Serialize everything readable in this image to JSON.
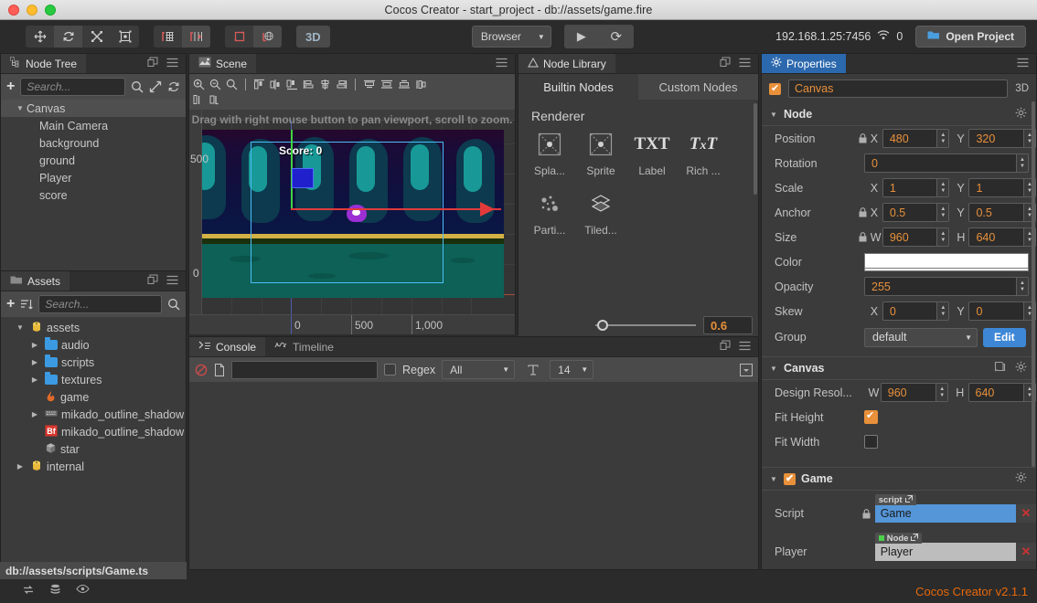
{
  "window": {
    "title": "Cocos Creator - start_project - db://assets/game.fire"
  },
  "toolbar": {
    "transform_tools": [
      {
        "name": "move-tool",
        "icon": "move-icon",
        "active": false
      },
      {
        "name": "rotate-tool",
        "icon": "rotate-icon",
        "active": true
      },
      {
        "name": "scale-tool",
        "icon": "scale-icon",
        "active": false
      },
      {
        "name": "rect-tool",
        "icon": "rect-transform-icon",
        "active": false
      }
    ],
    "snap_tools": [
      {
        "name": "snap-grid-tool",
        "icon": "snap-grid-icon"
      },
      {
        "name": "snap-point-tool",
        "icon": "snap-point-icon"
      }
    ],
    "pivot_tools": [
      {
        "name": "pivot-tool",
        "icon": "pivot-icon"
      },
      {
        "name": "global-coord-tool",
        "icon": "globe-icon"
      }
    ],
    "btn_3d": "3D",
    "preview_target": "Browser",
    "play_label": "play-icon",
    "refresh_label": "refresh-icon",
    "ip_address": "192.168.1.25:7456",
    "wifi_icon": "wifi-icon",
    "connection_count": "0",
    "open_project_label": "Open Project"
  },
  "node_tree": {
    "tab_label": "Node Tree",
    "tab_icon": "node-tree-icon",
    "add_icon": "plus-icon",
    "search_placeholder": "Search...",
    "search_value": "",
    "search_icon": "search-icon",
    "expand_icon": "expand-icon",
    "refresh_icon": "refresh-icon",
    "float_icon": "float-panel-icon",
    "menu_icon": "hamburger-icon",
    "nodes": [
      {
        "label": "Canvas",
        "depth": 0,
        "expanded": true,
        "selected": true
      },
      {
        "label": "Main Camera",
        "depth": 1,
        "expanded": null,
        "selected": false
      },
      {
        "label": "background",
        "depth": 1,
        "expanded": null,
        "selected": false
      },
      {
        "label": "ground",
        "depth": 1,
        "expanded": null,
        "selected": false
      },
      {
        "label": "Player",
        "depth": 1,
        "expanded": null,
        "selected": false
      },
      {
        "label": "score",
        "depth": 1,
        "expanded": null,
        "selected": false
      }
    ]
  },
  "assets": {
    "tab_label": "Assets",
    "tab_icon": "folder-icon",
    "add_icon": "plus-icon",
    "sort_icon": "sort-icon",
    "search_placeholder": "Search...",
    "search_value": "",
    "search_icon": "search-icon",
    "float_icon": "float-panel-icon",
    "menu_icon": "hamburger-icon",
    "items": [
      {
        "label": "assets",
        "depth": 0,
        "icon": "db-icon",
        "arrow": "down"
      },
      {
        "label": "audio",
        "depth": 1,
        "icon": "folder-icon",
        "arrow": "right"
      },
      {
        "label": "scripts",
        "depth": 1,
        "icon": "folder-icon",
        "arrow": "right"
      },
      {
        "label": "textures",
        "depth": 1,
        "icon": "folder-icon",
        "arrow": "right"
      },
      {
        "label": "game",
        "depth": 1,
        "icon": "fire-icon",
        "arrow": "none"
      },
      {
        "label": "mikado_outline_shadow",
        "depth": 1,
        "icon": "font-atlas-icon",
        "arrow": "right"
      },
      {
        "label": "mikado_outline_shadow",
        "depth": 1,
        "icon": "bitmap-font-icon",
        "arrow": "none"
      },
      {
        "label": "star",
        "depth": 1,
        "icon": "prefab-icon",
        "arrow": "none"
      },
      {
        "label": "internal",
        "depth": 0,
        "icon": "db-icon",
        "arrow": "right"
      }
    ],
    "breadcrumb": "db://assets/scripts/Game.ts"
  },
  "scene": {
    "tab_label": "Scene",
    "tab_icon": "scene-icon",
    "menu_icon": "hamburger-icon",
    "tool_row_1": [
      "zoom-in-icon",
      "zoom-out-icon",
      "zoom-reset-icon",
      "separator",
      "align-left-icon",
      "align-h-center-icon",
      "align-right-icon",
      "dist-left-icon",
      "dist-h-center-icon",
      "dist-right-icon",
      "separator",
      "align-top-icon",
      "align-v-center-icon",
      "align-bottom-icon",
      "dist-top-icon"
    ],
    "tool_row_2": [
      "dist-v-center-icon",
      "dist-bottom-icon"
    ],
    "hint_text": "Drag with right mouse button to pan viewport, scroll to zoom.",
    "ruler_x_labels": [
      "0",
      "500",
      "1,000"
    ],
    "ruler_y_labels": [
      "500",
      "0"
    ],
    "score_overlay": "Score: 0"
  },
  "node_library": {
    "tab_label": "Node Library",
    "tab_icon": "triangle-icon",
    "float_icon": "float-panel-icon",
    "menu_icon": "hamburger-icon",
    "tabs": [
      {
        "label": "Builtin Nodes",
        "active": true
      },
      {
        "label": "Custom Nodes",
        "active": false
      }
    ],
    "section_title": "Renderer",
    "items": [
      {
        "label": "Spla...",
        "icon": "sprite-splash-icon"
      },
      {
        "label": "Sprite",
        "icon": "sprite-icon"
      },
      {
        "label": "Label",
        "icon": "label-txt-icon"
      },
      {
        "label": "Rich ...",
        "icon": "richtext-icon"
      },
      {
        "label": "Parti...",
        "icon": "particle-icon"
      },
      {
        "label": "Tiled...",
        "icon": "tiled-map-icon"
      }
    ],
    "zoom_value": "0.6"
  },
  "console": {
    "tabs": [
      {
        "label": "Console",
        "icon": "console-icon",
        "active": true
      },
      {
        "label": "Timeline",
        "icon": "timeline-icon",
        "active": false
      }
    ],
    "float_icon": "float-panel-icon",
    "menu_icon": "hamburger-icon",
    "clear_icon": "clear-icon",
    "file_icon": "file-icon",
    "filter_value": "",
    "regex_label": "Regex",
    "regex_checked": false,
    "level_filter": "All",
    "text_icon": "text-size-icon",
    "font_size": "14",
    "collapse_icon": "collapse-icon",
    "messages": []
  },
  "properties": {
    "tab_label": "Properties",
    "tab_icon": "gear-icon",
    "menu_icon": "hamburger-icon",
    "node_enabled": true,
    "node_name": "Canvas",
    "is_3d_label": "3D",
    "node_section": {
      "title": "Node",
      "gear_icon": "gear-icon",
      "position": {
        "label": "Position",
        "locked": true,
        "x_label": "X",
        "x": "480",
        "y_label": "Y",
        "y": "320"
      },
      "rotation": {
        "label": "Rotation",
        "value": "0"
      },
      "scale": {
        "label": "Scale",
        "x_label": "X",
        "x": "1",
        "y_label": "Y",
        "y": "1"
      },
      "anchor": {
        "label": "Anchor",
        "locked": true,
        "x_label": "X",
        "x": "0.5",
        "y_label": "Y",
        "y": "0.5"
      },
      "size": {
        "label": "Size",
        "locked": true,
        "w_label": "W",
        "w": "960",
        "h_label": "H",
        "h": "640"
      },
      "color": {
        "label": "Color",
        "value": "#FFFFFF"
      },
      "opacity": {
        "label": "Opacity",
        "value": "255"
      },
      "skew": {
        "label": "Skew",
        "x_label": "X",
        "x": "0",
        "y_label": "Y",
        "y": "0"
      },
      "group": {
        "label": "Group",
        "value": "default",
        "edit_label": "Edit"
      }
    },
    "canvas_section": {
      "title": "Canvas",
      "help_icon": "book-icon",
      "gear_icon": "gear-icon",
      "design_resolution": {
        "label": "Design Resol...",
        "w_label": "W",
        "w": "960",
        "h_label": "H",
        "h": "640"
      },
      "fit_height": {
        "label": "Fit Height",
        "checked": true
      },
      "fit_width": {
        "label": "Fit Width",
        "checked": false
      }
    },
    "game_section": {
      "title": "Game",
      "enabled": true,
      "gear_icon": "gear-icon",
      "script": {
        "label": "Script",
        "locked": true,
        "tag": "script",
        "value": "Game",
        "remove_icon": "remove-icon"
      },
      "player": {
        "label": "Player",
        "tag": "Node",
        "value": "Player",
        "remove_icon": "remove-icon"
      }
    }
  },
  "statusbar": {
    "icons": [
      "sync-icon",
      "database-icon",
      "eye-icon"
    ],
    "version": "Cocos Creator v2.1.1"
  },
  "colors": {
    "accent_blue": "#2b68ad",
    "orange_value": "#e8903a",
    "version_orange": "#e8690b",
    "edit_blue": "#3d87d6",
    "select_blue": "#4bbdf7"
  }
}
